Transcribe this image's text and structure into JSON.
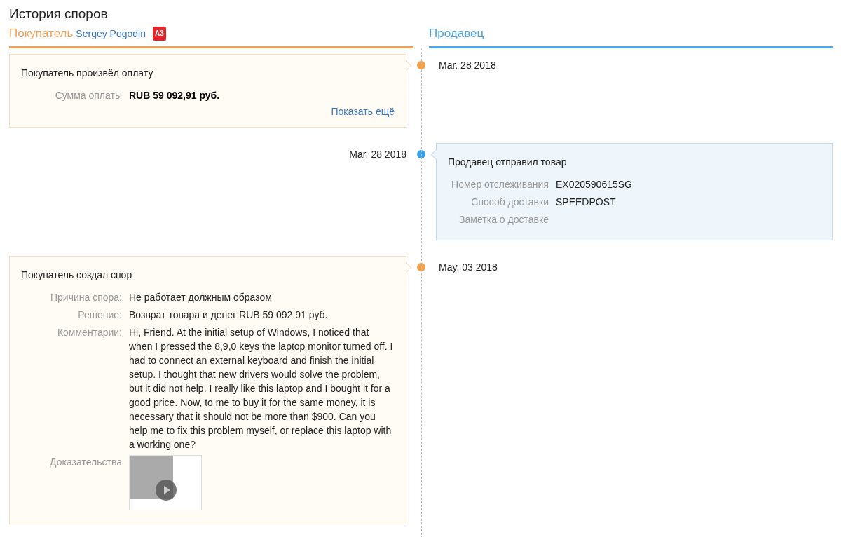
{
  "title": "История споров",
  "buyer": {
    "label": "Покупатель",
    "name": "Sergey Pogodin",
    "badge": "A3"
  },
  "seller": {
    "label": "Продавец"
  },
  "events": [
    {
      "kind": "buyer",
      "date": "Mar. 28 2018",
      "title": "Покупатель произвёл оплату",
      "fields": [
        {
          "kind": "amount",
          "label": "Сумма оплаты",
          "value": "RUB 59 092,91 руб."
        }
      ],
      "more_link": "Показать ещё"
    },
    {
      "kind": "seller",
      "date": "Mar. 28 2018",
      "title": "Продавец отправил товар",
      "fields": [
        {
          "kind": "text",
          "label": "Номер отслеживания",
          "value": "EX020590615SG"
        },
        {
          "kind": "text",
          "label": "Способ доставки",
          "value": "SPEEDPOST"
        },
        {
          "kind": "text",
          "label": "Заметка о доставке"
        }
      ]
    },
    {
      "kind": "buyer",
      "date": "May. 03 2018",
      "title": "Покупатель создал спор",
      "fields": [
        {
          "kind": "text",
          "label": "Причина спора:",
          "value": "Не работает должным образом"
        },
        {
          "kind": "text",
          "label": "Решение:",
          "value": "Возврат товара и денег RUB 59 092,91 руб."
        },
        {
          "kind": "text",
          "label": "Комментарии:",
          "value": "Hi, Friend. At the initial setup of Windows, I noticed that when I pressed the 8,9,0 keys the laptop monitor turned off. I had to connect an external keyboard and finish the initial setup. I thought that new drivers would solve the problem, but it did not help. I really like this laptop and I bought it for a good price. Now, to me to buy it for the same money, it is necessary that it should not be more than $900. Can you help me to fix this problem myself, or replace this laptop with a working one?"
        },
        {
          "kind": "video",
          "label": "Доказательства"
        }
      ]
    }
  ]
}
